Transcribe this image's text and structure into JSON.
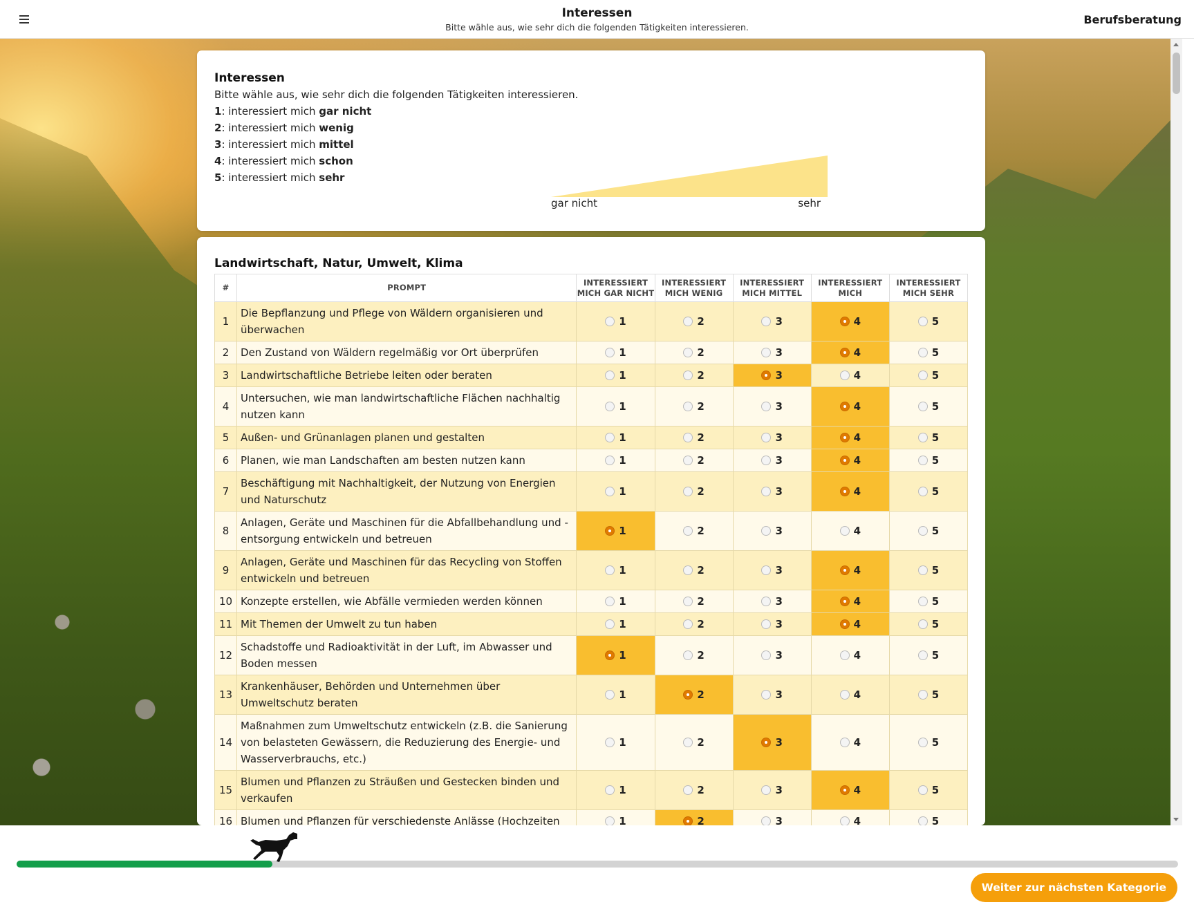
{
  "header": {
    "title": "Interessen",
    "subtitle": "Bitte wähle aus, wie sehr dich die folgenden Tätigkeiten interessieren.",
    "brand": "Berufsberatung",
    "menu_icon": "hamburger-menu-icon"
  },
  "intro": {
    "title": "Interessen",
    "description": "Bitte wähle aus, wie sehr dich die folgenden Tätigkeiten interessieren.",
    "scale": [
      {
        "num": "1",
        "text": ": interessiert mich ",
        "bold": "gar nicht"
      },
      {
        "num": "2",
        "text": ": interessiert mich ",
        "bold": "wenig"
      },
      {
        "num": "3",
        "text": ": interessiert mich ",
        "bold": "mittel"
      },
      {
        "num": "4",
        "text": ": interessiert mich ",
        "bold": "schon"
      },
      {
        "num": "5",
        "text": ": interessiert mich ",
        "bold": "sehr"
      }
    ],
    "ramp_low": "gar nicht",
    "ramp_high": "sehr",
    "ramp_color": "#fce38a"
  },
  "section": {
    "title": "Landwirtschaft, Natur, Umwelt, Klima",
    "columns": {
      "num": "#",
      "prompt": "Prompt",
      "o1": "Interessiert mich gar nicht",
      "o2": "Interessiert mich wenig",
      "o3": "Interessiert mich mittel",
      "o4": "Interessiert mich",
      "o5": "Interessiert mich sehr"
    },
    "options": [
      "1",
      "2",
      "3",
      "4",
      "5"
    ],
    "rows": [
      {
        "num": "1",
        "prompt": "Die Bepflanzung und Pflege von Wäldern organisieren und überwachen",
        "selected": 4
      },
      {
        "num": "2",
        "prompt": "Den Zustand von Wäldern regelmäßig vor Ort überprüfen",
        "selected": 4
      },
      {
        "num": "3",
        "prompt": "Landwirtschaftliche Betriebe leiten oder beraten",
        "selected": 3
      },
      {
        "num": "4",
        "prompt": "Untersuchen, wie man landwirtschaftliche Flächen nachhaltig nutzen kann",
        "selected": 4
      },
      {
        "num": "5",
        "prompt": "Außen- und Grünanlagen planen und gestalten",
        "selected": 4
      },
      {
        "num": "6",
        "prompt": "Planen, wie man Landschaften am besten nutzen kann",
        "selected": 4
      },
      {
        "num": "7",
        "prompt": "Beschäftigung mit Nachhaltigkeit, der Nutzung von Energien und Naturschutz",
        "selected": 4
      },
      {
        "num": "8",
        "prompt": "Anlagen, Geräte und Maschinen für die Abfallbehandlung und -entsorgung entwickeln und betreuen",
        "selected": 1
      },
      {
        "num": "9",
        "prompt": "Anlagen, Geräte und Maschinen für das Recycling von Stoffen entwickeln und betreuen",
        "selected": 4
      },
      {
        "num": "10",
        "prompt": "Konzepte erstellen, wie Abfälle vermieden werden können",
        "selected": 4
      },
      {
        "num": "11",
        "prompt": "Mit Themen der Umwelt zu tun haben",
        "selected": 4
      },
      {
        "num": "12",
        "prompt": "Schadstoffe und Radioaktivität in der Luft, im Abwasser und Boden messen",
        "selected": 1
      },
      {
        "num": "13",
        "prompt": "Krankenhäuser, Behörden und Unternehmen über Umweltschutz beraten",
        "selected": 2
      },
      {
        "num": "14",
        "prompt": "Maßnahmen zum Umweltschutz entwickeln (z.B. die Sanierung von belasteten Gewässern, die Reduzierung des Energie- und Wasserverbrauchs, etc.)",
        "selected": 3
      },
      {
        "num": "15",
        "prompt": "Blumen und Pflanzen zu Sträußen und Gestecken binden und verkaufen",
        "selected": 4
      },
      {
        "num": "16",
        "prompt": "Blumen und Pflanzen für verschiedenste Anlässe (Hochzeiten",
        "selected": 2
      }
    ]
  },
  "progress": {
    "fraction": 0.22,
    "color": "#139e4a",
    "icon": "running-horse-icon"
  },
  "footer": {
    "next_label": "Weiter zur nächsten Kategorie",
    "button_color": "#f59f0b"
  },
  "colors": {
    "selected_cell": "#f9be2f",
    "row_odd": "#fdf0c0",
    "row_even": "#fffaea",
    "radio_checked": "#e07a00"
  }
}
